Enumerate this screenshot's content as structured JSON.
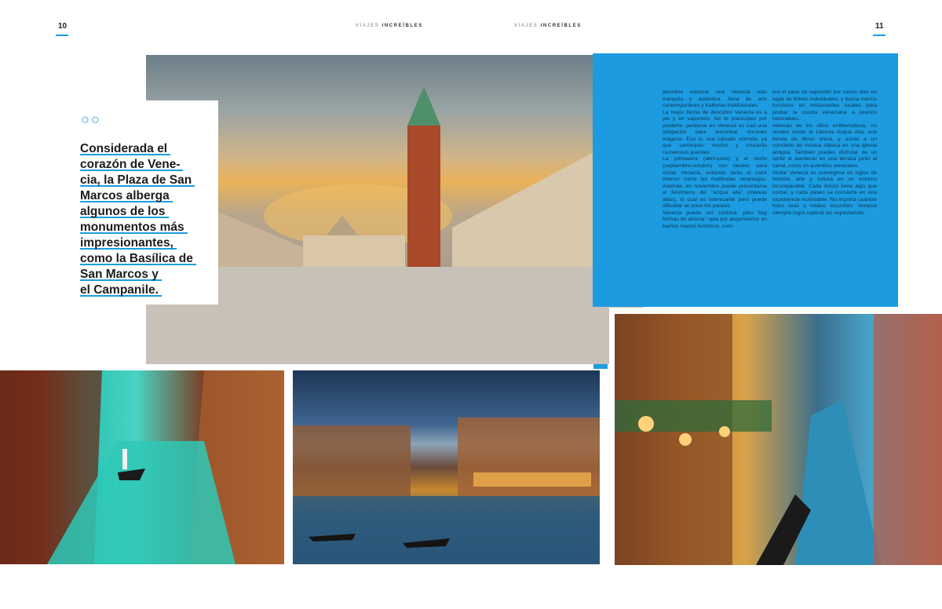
{
  "header": {
    "left_page_number": "10",
    "right_page_number": "11",
    "running_head_prefix": "VIAJES",
    "running_head_bold": "INCREÍBLES"
  },
  "colors": {
    "accent": "#1a9ee0",
    "panel": "#1c9be0",
    "text": "#1c1c1c"
  },
  "quote": {
    "marks": "○○",
    "lines": [
      "Considerada el",
      "corazón de Vene-",
      "cia, la Plaza de San",
      "Marcos alberga",
      "algunos de los",
      "monumentos más",
      "impresionantes,",
      "como la Basílica de",
      "San Marcos y",
      "el Campanile."
    ]
  },
  "article": {
    "column1": [
      "permiten explorar una Venecia más tranquila y auténtica, llena de arte contemporáneo y trattorias tradicionales.",
      "La mejor forma de descubrir Venecia es a pie y en vaporetto. No te preocupes por perderte: perderse en Venecia es casi una obligación para encontrar rincones mágicos. Eso sí, usa calzado cómodo, ya que caminarás mucho y cruzarás numerosos puentes.",
      "La primavera (abril-junio) y el otoño (septiembre-octubre) son ideales para visitar Venecia, evitando tanto el calor intenso como las multitudes veraniegas. Además, en noviembre puede presentarse el fenómeno del \"acqua alta\" (mareas altas), lo cual es interesante pero puede dificultar un poco los paseos.",
      "Venecia puede ser costosa, pero hay formas de ahorrar: opta por alojamientos en barrios menos turísticos, com-"
    ],
    "column2": [
      "pra el pase de vaporetto por varios días en lugar de tickets individuales, y busca menús turísticos en restaurantes locales para probar la cocina veneciana a precios razonables.",
      "Además de los sitios emblemáticos, no olvides visitar la Librería Acqua Alta, una tienda de libros única, y asiste a un concierto de música clásica en una iglesia antigua. También puedes disfrutar de un spritz al atardecer en una terraza junto al canal, como un auténtico veneciano.",
      "Visitar Venecia es sumergirse en siglos de historia, arte y cultura en un entorno incomparable. Cada rincón tiene algo que contar, y cada paseo se convierte en una experiencia inolvidable. No importa cuántas fotos veas o relatos escuches: Venecia siempre logra superar las expectativas."
    ]
  }
}
